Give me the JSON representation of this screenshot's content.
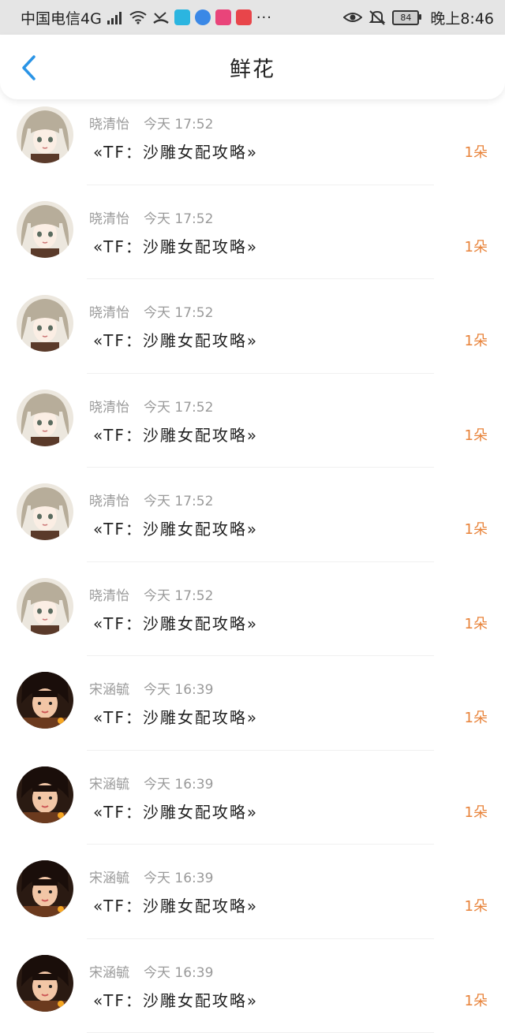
{
  "status_bar": {
    "carrier": "中国电信4G",
    "network": "4G",
    "battery": "84",
    "time": "晚上8:46",
    "more": "···",
    "app_icons": [
      {
        "name": "book-app-icon",
        "color": "#2bb5e0"
      },
      {
        "name": "browser-app-icon",
        "color": "#3a88e6"
      },
      {
        "name": "video-app-icon",
        "color": "#e9447a"
      },
      {
        "name": "huawei-app-icon",
        "color": "#e8454a"
      }
    ]
  },
  "nav": {
    "title": "鲜花",
    "accent": "#2a94e6"
  },
  "rows": [
    {
      "user": "晓清怡",
      "time": "今天 17:52",
      "book": "«TF：沙雕女配攻略»",
      "count": "1朵",
      "avatar": "light"
    },
    {
      "user": "晓清怡",
      "time": "今天 17:52",
      "book": "«TF：沙雕女配攻略»",
      "count": "1朵",
      "avatar": "light"
    },
    {
      "user": "晓清怡",
      "time": "今天 17:52",
      "book": "«TF：沙雕女配攻略»",
      "count": "1朵",
      "avatar": "light"
    },
    {
      "user": "晓清怡",
      "time": "今天 17:52",
      "book": "«TF：沙雕女配攻略»",
      "count": "1朵",
      "avatar": "light"
    },
    {
      "user": "晓清怡",
      "time": "今天 17:52",
      "book": "«TF：沙雕女配攻略»",
      "count": "1朵",
      "avatar": "light"
    },
    {
      "user": "晓清怡",
      "time": "今天 17:52",
      "book": "«TF：沙雕女配攻略»",
      "count": "1朵",
      "avatar": "light"
    },
    {
      "user": "宋涵毓",
      "time": "今天 16:39",
      "book": "«TF：沙雕女配攻略»",
      "count": "1朵",
      "avatar": "dark"
    },
    {
      "user": "宋涵毓",
      "time": "今天 16:39",
      "book": "«TF：沙雕女配攻略»",
      "count": "1朵",
      "avatar": "dark"
    },
    {
      "user": "宋涵毓",
      "time": "今天 16:39",
      "book": "«TF：沙雕女配攻略»",
      "count": "1朵",
      "avatar": "dark"
    },
    {
      "user": "宋涵毓",
      "time": "今天 16:39",
      "book": "«TF：沙雕女配攻略»",
      "count": "1朵",
      "avatar": "dark"
    }
  ],
  "colors": {
    "count": "#e8833a",
    "meta": "#9a9a9a",
    "text": "#222222"
  }
}
